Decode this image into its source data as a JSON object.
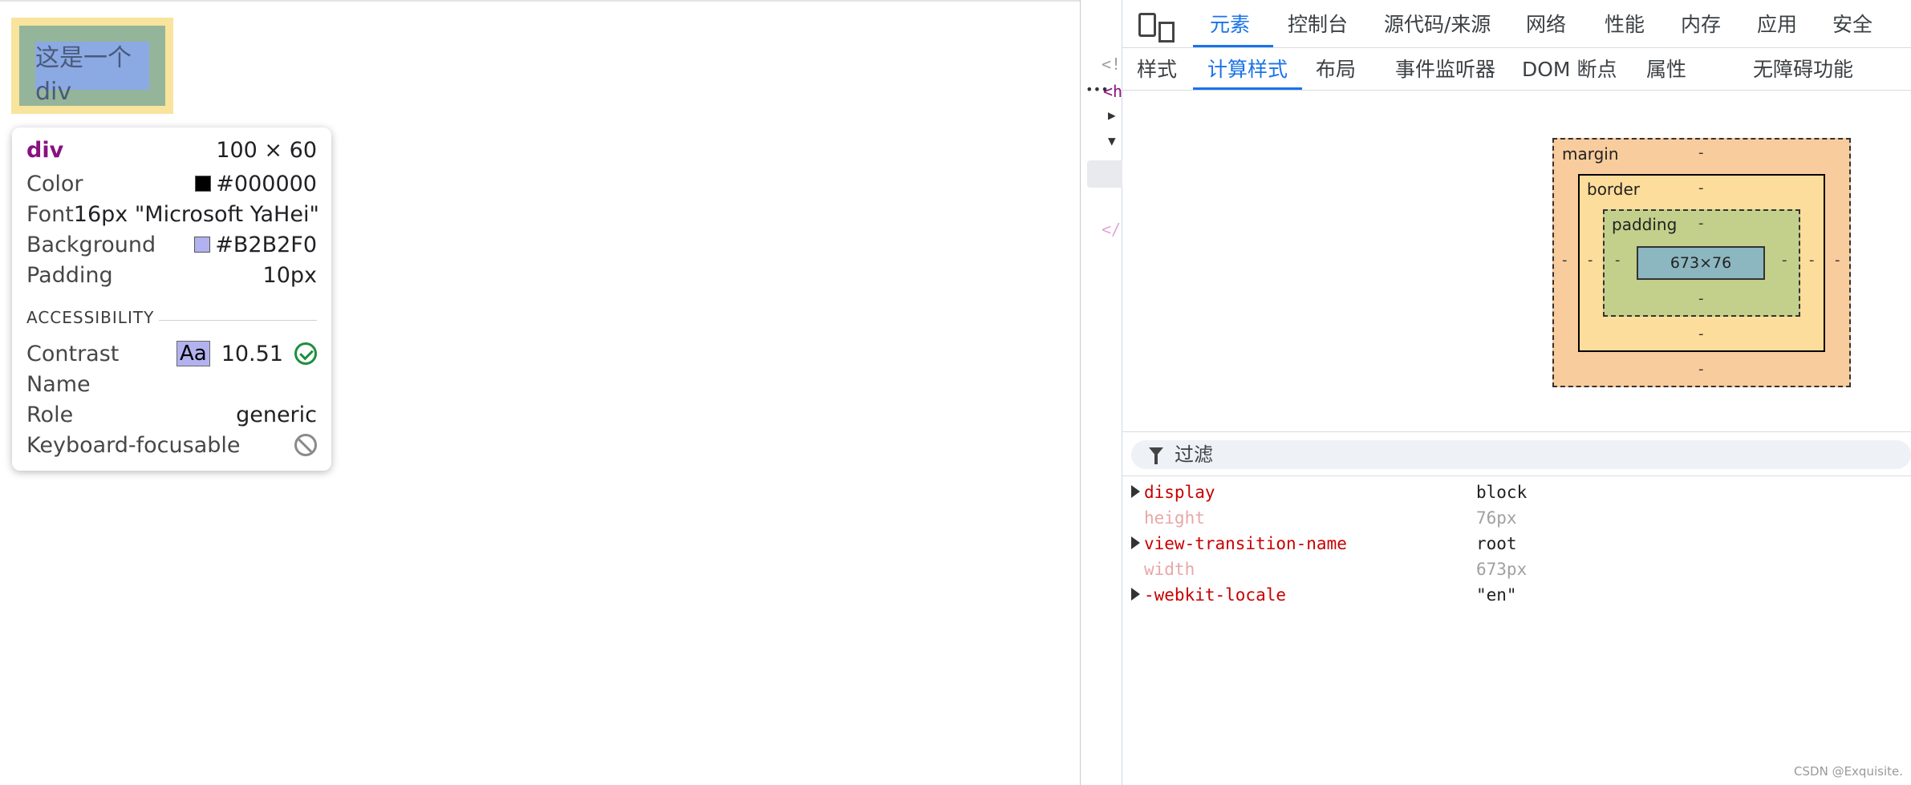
{
  "viewport": {
    "div_text": "这是一个div"
  },
  "tooltip": {
    "tag": "div",
    "size": "100 × 60",
    "color_label": "Color",
    "color_value": "#000000",
    "color_swatch": "#000000",
    "font_label": "Font",
    "font_value": "16px \"Microsoft YaHei\"",
    "background_label": "Background",
    "background_value": "#B2B2F0",
    "background_swatch": "#B2B2F0",
    "padding_label": "Padding",
    "padding_value": "10px",
    "accessibility_title": "ACCESSIBILITY",
    "contrast_label": "Contrast",
    "contrast_sample": "Aa",
    "contrast_value": "10.51",
    "name_label": "Name",
    "role_label": "Role",
    "role_value": "generic",
    "keyboard_label": "Keyboard-focusable"
  },
  "devtools": {
    "main_tabs": [
      "元素",
      "控制台",
      "源代码/来源",
      "网络",
      "性能",
      "内存",
      "应用",
      "安全"
    ],
    "active_main_tab": "元素",
    "sub_tabs": [
      "样式",
      "计算样式",
      "布局",
      "事件监听器",
      "DOM 断点",
      "属性",
      "无障碍功能"
    ],
    "active_sub_tab": "计算样式",
    "dom_glyphs": [
      "<!",
      "<h",
      "</"
    ],
    "box_model": {
      "margin_label": "margin",
      "border_label": "border",
      "padding_label": "padding",
      "content_size": "673×76",
      "dash": "-"
    },
    "filter_placeholder": "过滤",
    "computed": [
      {
        "name": "display",
        "value": "block",
        "expandable": true,
        "dim": false
      },
      {
        "name": "height",
        "value": "76px",
        "expandable": false,
        "dim": true
      },
      {
        "name": "view-transition-name",
        "value": "root",
        "expandable": true,
        "dim": false
      },
      {
        "name": "width",
        "value": "673px",
        "expandable": false,
        "dim": true
      },
      {
        "name": "-webkit-locale",
        "value": "\"en\"",
        "expandable": true,
        "dim": false
      }
    ]
  },
  "watermark": "CSDN @Exquisite."
}
